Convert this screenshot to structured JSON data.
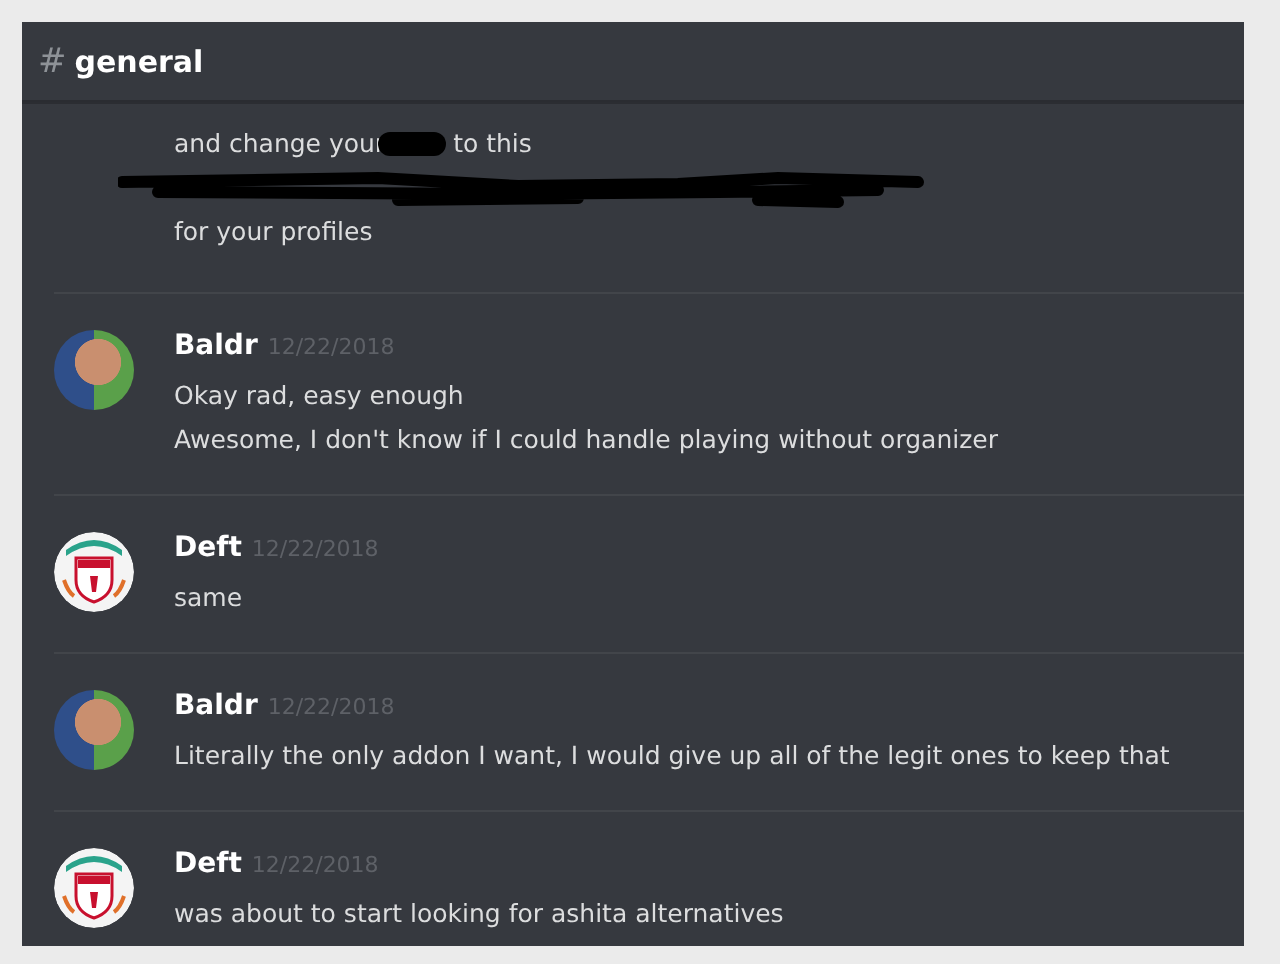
{
  "channel": {
    "hash": "#",
    "name": "general"
  },
  "continuation": [
    {
      "kind": "redacted_middle",
      "parts": [
        "and change your",
        "to this"
      ]
    },
    {
      "kind": "redacted"
    },
    {
      "kind": "text",
      "text": "for your profiles"
    }
  ],
  "messages": [
    {
      "author": "Baldr",
      "kind": "photo",
      "date": "12/22/2018",
      "lines": [
        "Okay rad, easy enough",
        "Awesome, I don't know if I could handle playing without organizer"
      ]
    },
    {
      "author": "Deft",
      "kind": "crest",
      "date": "12/22/2018",
      "lines": [
        "same"
      ]
    },
    {
      "author": "Baldr",
      "kind": "photo",
      "date": "12/22/2018",
      "lines": [
        "Literally the only addon I want, I would give up all of the legit ones to keep that"
      ]
    },
    {
      "author": "Deft",
      "kind": "crest",
      "date": "12/22/2018",
      "lines": [
        "was about to start looking for ashita alternatives"
      ]
    }
  ]
}
